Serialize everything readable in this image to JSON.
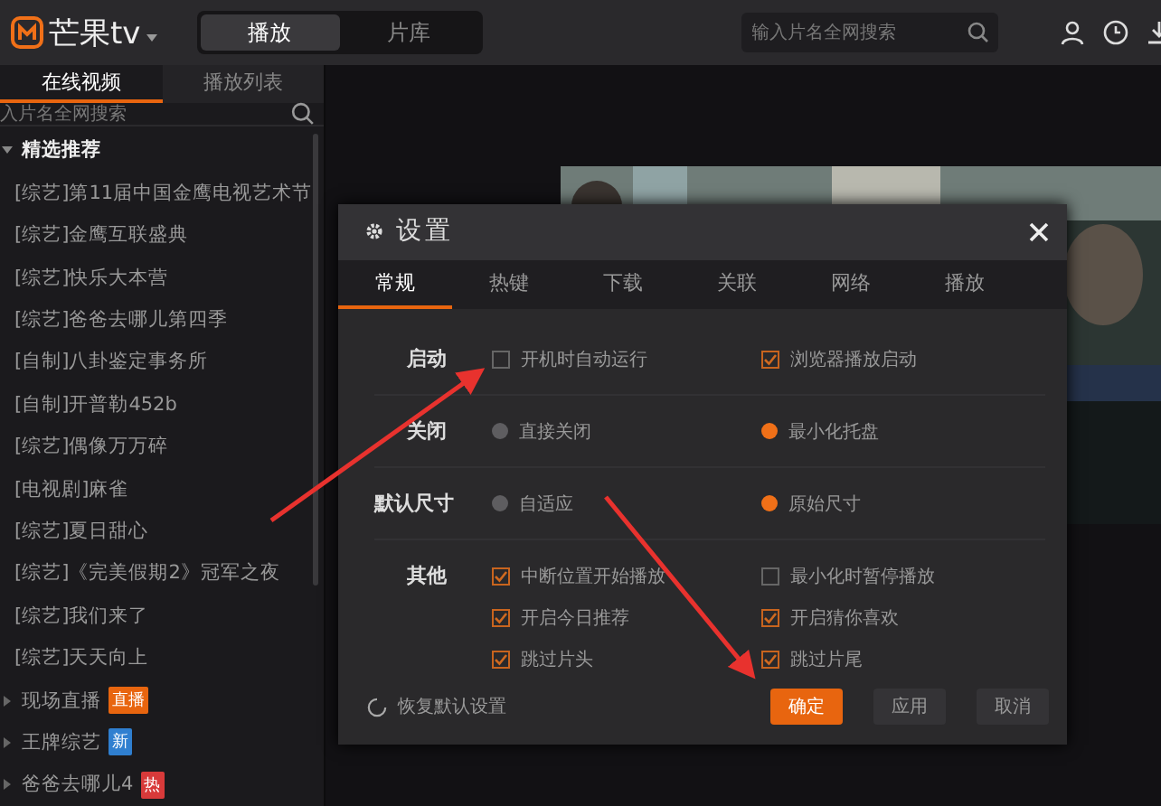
{
  "header": {
    "logo": "芒果tv",
    "mode_tabs": [
      {
        "label": "播放",
        "selected": true
      },
      {
        "label": "片库",
        "selected": false
      }
    ],
    "search": {
      "placeholder": "输入片名全网搜索"
    }
  },
  "sidebar": {
    "tabs": [
      {
        "label": "在线视频",
        "selected": true
      },
      {
        "label": "播放列表",
        "selected": false
      }
    ],
    "search": {
      "placeholder": "入片名全网搜索"
    },
    "tree": [
      {
        "label": "精选推荐",
        "expanded": true,
        "children": [
          {
            "label": "[综艺]第11届中国金鹰电视艺术节"
          },
          {
            "label": "[综艺]金鹰互联盛典"
          },
          {
            "label": "[综艺]快乐大本营"
          },
          {
            "label": "[综艺]爸爸去哪儿第四季"
          },
          {
            "label": "[自制]八卦鉴定事务所"
          },
          {
            "label": "[自制]开普勒452b"
          },
          {
            "label": "[综艺]偶像万万碎"
          },
          {
            "label": "[电视剧]麻雀"
          },
          {
            "label": "[综艺]夏日甜心"
          },
          {
            "label": "[综艺]《完美假期2》冠军之夜"
          },
          {
            "label": "[综艺]我们来了"
          },
          {
            "label": "[综艺]天天向上"
          }
        ]
      },
      {
        "label": "现场直播",
        "expanded": false,
        "badge": {
          "text": "直播",
          "color": "#e8650f"
        }
      },
      {
        "label": "王牌综艺",
        "expanded": false,
        "badge": {
          "text": "新",
          "color": "#2f7fd0"
        }
      },
      {
        "label": "爸爸去哪儿4",
        "expanded": false,
        "badge": {
          "text": "热",
          "color": "#d83a3a"
        }
      }
    ]
  },
  "dialog": {
    "title": "设置",
    "tabs": [
      {
        "label": "常规",
        "selected": true
      },
      {
        "label": "热键",
        "selected": false
      },
      {
        "label": "下载",
        "selected": false
      },
      {
        "label": "关联",
        "selected": false
      },
      {
        "label": "网络",
        "selected": false
      },
      {
        "label": "播放",
        "selected": false
      }
    ],
    "sections": [
      {
        "label": "启动",
        "options": [
          {
            "kind": "checkbox",
            "label": "开机时自动运行",
            "checked": false
          },
          {
            "kind": "checkbox",
            "label": "浏览器播放启动",
            "checked": true
          }
        ]
      },
      {
        "label": "关闭",
        "options": [
          {
            "kind": "radio",
            "label": "直接关闭",
            "selected": false
          },
          {
            "kind": "radio",
            "label": "最小化托盘",
            "selected": true
          }
        ]
      },
      {
        "label": "默认尺寸",
        "options": [
          {
            "kind": "radio",
            "label": "自适应",
            "selected": false
          },
          {
            "kind": "radio",
            "label": "原始尺寸",
            "selected": true
          }
        ]
      },
      {
        "label": "其他",
        "options": [
          {
            "kind": "checkbox",
            "label": "中断位置开始播放",
            "checked": true
          },
          {
            "kind": "checkbox",
            "label": "最小化时暂停播放",
            "checked": false
          },
          {
            "kind": "checkbox",
            "label": "开启今日推荐",
            "checked": true
          },
          {
            "kind": "checkbox",
            "label": "开启猜你喜欢",
            "checked": true
          },
          {
            "kind": "checkbox",
            "label": "跳过片头",
            "checked": true
          },
          {
            "kind": "checkbox",
            "label": "跳过片尾",
            "checked": true
          }
        ]
      }
    ],
    "reset": "恢复默认设置",
    "buttons": [
      {
        "label": "确定",
        "primary": true
      },
      {
        "label": "应用",
        "primary": false
      },
      {
        "label": "取消",
        "primary": false
      }
    ]
  }
}
